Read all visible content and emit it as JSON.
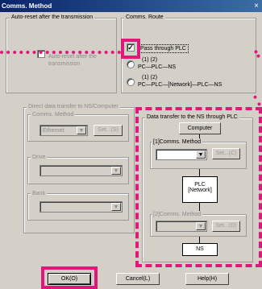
{
  "dialog": {
    "title": "Comms. Method",
    "close_glyph": "×",
    "auto_reset": {
      "group_title": "Auto-reset after the transmission",
      "checkbox_label_1": "Auto-reset after the",
      "checkbox_label_2": "transmission"
    },
    "route": {
      "group_title": "Comms. Route",
      "pass_through_label": "Pass through PLC",
      "option1_nums": "(1)     (2)",
      "option1_text": "PC—PLC—NS",
      "option2_nums": "(1)               (2)",
      "option2_text": "PC—PLC—[Network]—PLC—NS"
    },
    "direct": {
      "group_title": "Direct data transfer to NS/Computer",
      "comms_method_label": "Comms. Method",
      "comms_method_value": "Ethernet",
      "set_label": "Set...(S)",
      "drive_label": "Drive",
      "bank_label": "Bank"
    },
    "via_plc": {
      "group_title": "Data transfer to the NS through PLC",
      "computer_label": "Computer",
      "comms1_label": "[1]Comms. Method",
      "set1_label": "Set...(C)",
      "plc_line1": "PLC",
      "plc_line2": "[Network]",
      "comms2_label": "[2]Comms. Method",
      "set2_label": "Set...(D)",
      "ns_label": "NS"
    },
    "buttons": {
      "ok": "OK(O)",
      "cancel": "Cancel(L)",
      "help": "Help(H)"
    }
  },
  "highlight_color": "#e0187c"
}
